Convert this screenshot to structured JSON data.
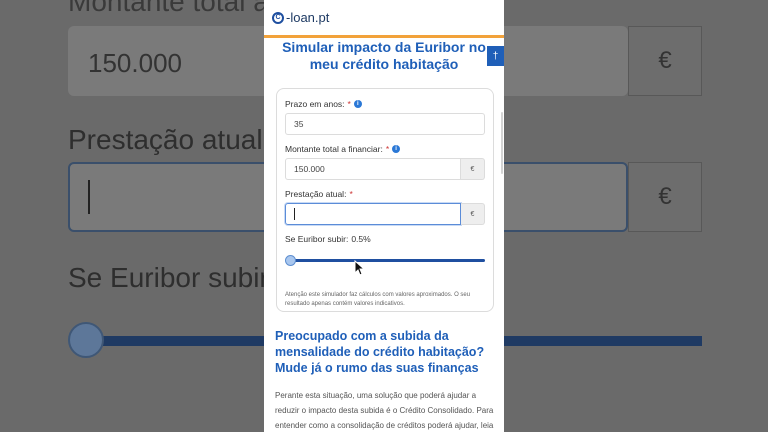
{
  "background": {
    "heading_partial": "Montante total a",
    "amount_value": "150.000",
    "euro": "€",
    "label_prestacao": "Prestação atual:",
    "label_euribor": "Se Euribor subir:"
  },
  "header": {
    "logo_mark": "C",
    "logo_text": "-loan.pt"
  },
  "accessibility_icon": "†",
  "title": "Simular impacto da Euribor no meu crédito habitação",
  "form": {
    "prazo": {
      "label": "Prazo em anos:",
      "required": "*",
      "value": "35"
    },
    "montante": {
      "label": "Montante total a financiar:",
      "required": "*",
      "value": "150.000",
      "unit": "€"
    },
    "prestacao": {
      "label": "Prestação atual:",
      "required": "*",
      "value": "",
      "unit": "€"
    },
    "euribor": {
      "label": "Se Euribor subir:",
      "value": "0.5%",
      "slider_fraction": 0
    },
    "note": "Atenção este simulador faz cálculos com valores aproximados. O seu resultado apenas contém valores indicativos."
  },
  "promo_heading": "Preocupado com a subida da mensalidade do crédito habitação? Mude já o rumo das suas finanças",
  "body_text": "Perante esta situação, uma solução que poderá ajudar a reduzir o impacto desta subida é o Crédito Consolidado. Para entender como a consolidação de créditos poderá ajudar, leia",
  "colors": {
    "brand_blue": "#1f5fb8",
    "accent_orange": "#f2a23a"
  }
}
